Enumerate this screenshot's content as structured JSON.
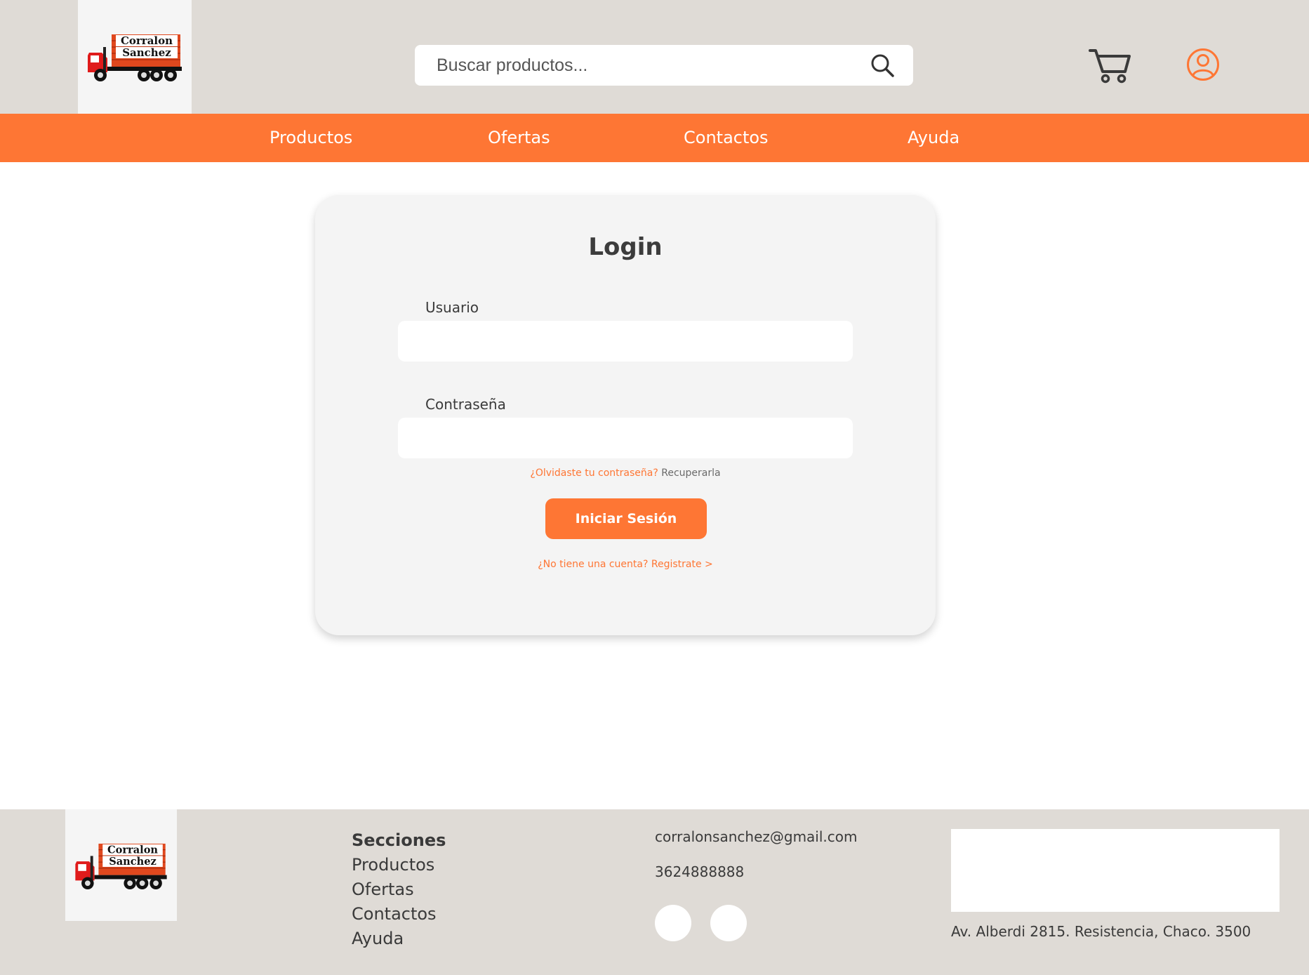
{
  "brand": {
    "logo_line1": "Corralon",
    "logo_line2": "Sanchez",
    "accent": "#fe7634",
    "header_bg": "#dfdbd6"
  },
  "header": {
    "search_placeholder": "Buscar productos...",
    "icons": [
      "search-icon",
      "cart-icon",
      "user-icon"
    ]
  },
  "nav": {
    "items": [
      "Productos",
      "Ofertas",
      "Contactos",
      "Ayuda"
    ]
  },
  "login": {
    "title": "Login",
    "user_label": "Usuario",
    "user_value": "",
    "password_label": "Contraseña",
    "password_value": "",
    "forgot_question": "¿Olvidaste tu contraseña?",
    "forgot_link": "Recuperarla",
    "submit": "Iniciar Sesión",
    "register": "¿No tiene una cuenta? Registrate >"
  },
  "footer": {
    "sections_title": "Secciones",
    "sections": [
      "Productos",
      "Ofertas",
      "Contactos",
      "Ayuda"
    ],
    "email": "corralonsanchez@gmail.com",
    "phone": "3624888888",
    "address": "Av. Alberdi 2815. Resistencia, Chaco. 3500"
  }
}
